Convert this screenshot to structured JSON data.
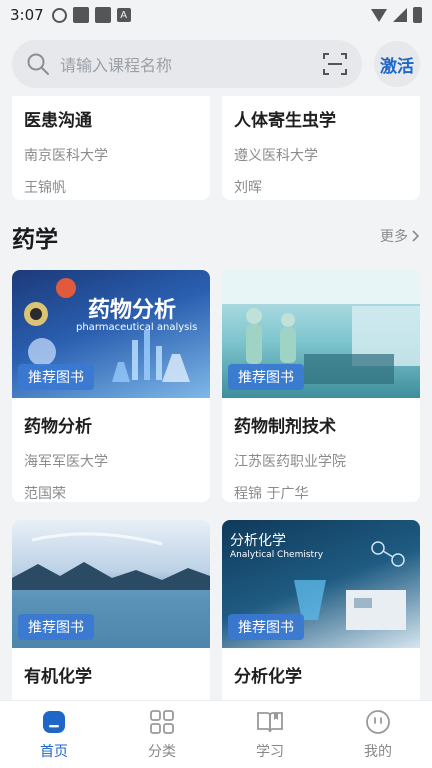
{
  "status_bar": {
    "time": "3:07"
  },
  "search": {
    "placeholder": "请输入课程名称",
    "activate_label": "激活"
  },
  "top_courses": [
    {
      "title": "医患沟通",
      "school": "南京医科大学",
      "author": "王锦帆"
    },
    {
      "title": "人体寄生虫学",
      "school": "遵义医科大学",
      "author": "刘晖"
    }
  ],
  "pharmacy": {
    "section_title": "药学",
    "more_label": "更多",
    "courses": [
      {
        "title": "药物分析",
        "school": "海军军医大学",
        "author": "范国荣",
        "badge": "推荐图书",
        "cover_text": "药物分析",
        "cover_subtext": "pharmaceutical analysis"
      },
      {
        "title": "药物制剂技术",
        "school": "江苏医药职业学院",
        "author": "程锦 于广华",
        "badge": "推荐图书"
      },
      {
        "title": "有机化学",
        "badge": "推荐图书"
      },
      {
        "title": "分析化学",
        "badge": "推荐图书",
        "cover_text": "分析化学",
        "cover_subtext": "Analytical Chemistry"
      }
    ]
  },
  "tabbar": {
    "items": [
      {
        "label": "首页",
        "icon": "home-icon",
        "active": true
      },
      {
        "label": "分类",
        "icon": "grid-icon",
        "active": false
      },
      {
        "label": "学习",
        "icon": "book-icon",
        "active": false
      },
      {
        "label": "我的",
        "icon": "profile-icon",
        "active": false
      }
    ]
  },
  "colors": {
    "accent": "#1e67c8",
    "badge": "#3a78d2",
    "background": "#f2f3f5"
  }
}
